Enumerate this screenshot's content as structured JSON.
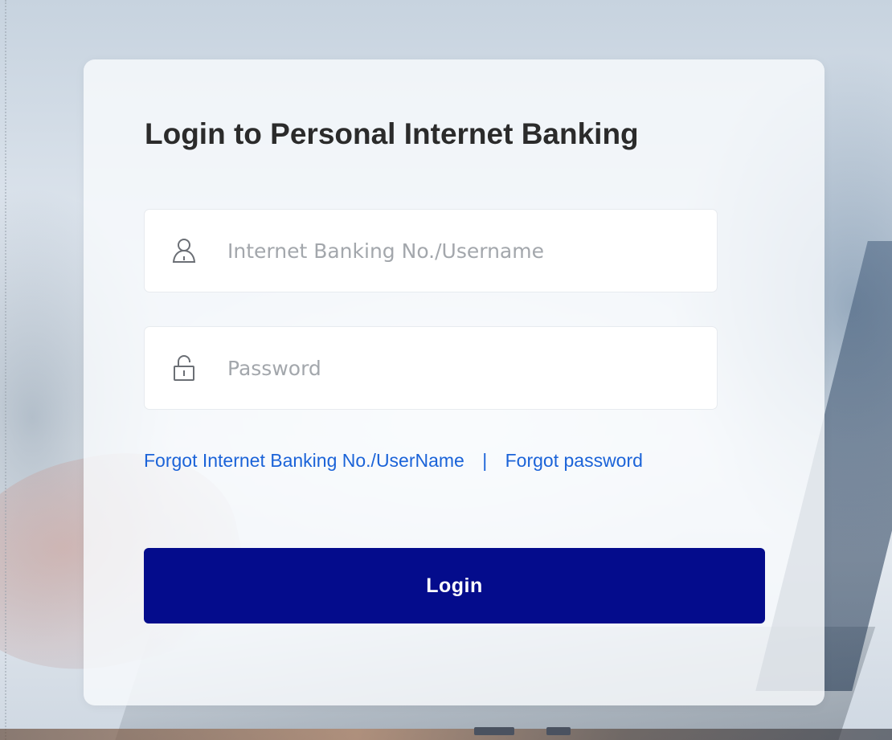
{
  "page": {
    "title": "Login to Personal Internet Banking"
  },
  "form": {
    "username": {
      "placeholder": "Internet Banking No./Username",
      "value": "",
      "icon": "user-icon"
    },
    "password": {
      "placeholder": "Password",
      "value": "",
      "icon": "lock-icon"
    },
    "links": {
      "forgot_username": "Forgot Internet Banking No./UserName",
      "separator": "|",
      "forgot_password": "Forgot password"
    },
    "submit_label": "Login"
  },
  "colors": {
    "primary_button": "#040c8c",
    "link": "#1b63d8",
    "title": "#2b2b2b",
    "placeholder": "#a3a7ac"
  }
}
